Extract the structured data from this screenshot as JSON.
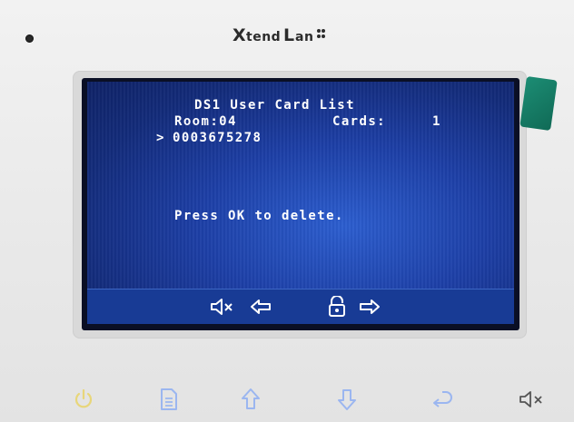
{
  "brand": {
    "text": "XtendLan"
  },
  "screen": {
    "title": "DS1 User Card List",
    "room_label": "Room:04",
    "cards_label": "Cards:",
    "cards_count": "1",
    "selector": ">",
    "card_number": "0003675278",
    "prompt": "Press OK to delete."
  },
  "softkeys": [
    "mute-icon",
    "arrow-left-icon",
    "unlock-icon",
    "arrow-right-icon"
  ],
  "hardware_buttons": [
    "power-icon",
    "document-icon",
    "arrow-up-icon",
    "arrow-down-icon",
    "return-icon",
    "mute-icon"
  ],
  "colors": {
    "screen_blue": "#1d3fa6",
    "power_yellow": "#e8d67a",
    "button_blue": "#9bb6f0"
  }
}
